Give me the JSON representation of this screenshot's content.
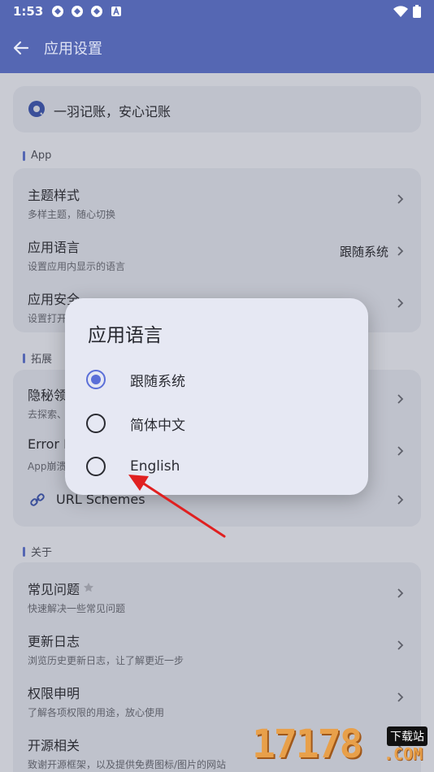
{
  "status": {
    "time": "1:53"
  },
  "appbar": {
    "title": "应用设置",
    "back_icon": "arrow-left-icon"
  },
  "banner": {
    "text": "一羽记账，安心记账"
  },
  "sections": {
    "app": {
      "label": "App",
      "items": [
        {
          "title": "主题样式",
          "subtitle": "多样主题，随心切换"
        },
        {
          "title": "应用语言",
          "subtitle": "设置应用内显示的语言",
          "value": "跟随系统"
        },
        {
          "title": "应用安全",
          "subtitle": "设置打开"
        }
      ]
    },
    "ext": {
      "label": "拓展",
      "items": [
        {
          "title": "隐秘领",
          "subtitle": "去探索、"
        },
        {
          "title": "Error L",
          "subtitle": "App崩溃"
        },
        {
          "title": "URL Schemes"
        }
      ]
    },
    "about": {
      "label": "关于",
      "items": [
        {
          "title": "常见问题",
          "subtitle": "快速解决一些常见问题"
        },
        {
          "title": "更新日志",
          "subtitle": "浏览历史更新日志，让了解更近一步"
        },
        {
          "title": "权限申明",
          "subtitle": "了解各项权限的用途，放心使用"
        },
        {
          "title": "开源相关",
          "subtitle": "致谢开源框架，以及提供免费图标/图片的网站"
        }
      ]
    }
  },
  "dialog": {
    "title": "应用语言",
    "options": [
      {
        "label": "跟随系统",
        "selected": true
      },
      {
        "label": "简体中文",
        "selected": false
      },
      {
        "label": "English",
        "selected": false
      }
    ]
  },
  "watermark": {
    "number": "17178",
    "tag": "下载站",
    "domain": ".COM"
  },
  "colors": {
    "accent": "#5b6fd8",
    "appbar": "#5567b3",
    "arrow": "#e02020"
  }
}
